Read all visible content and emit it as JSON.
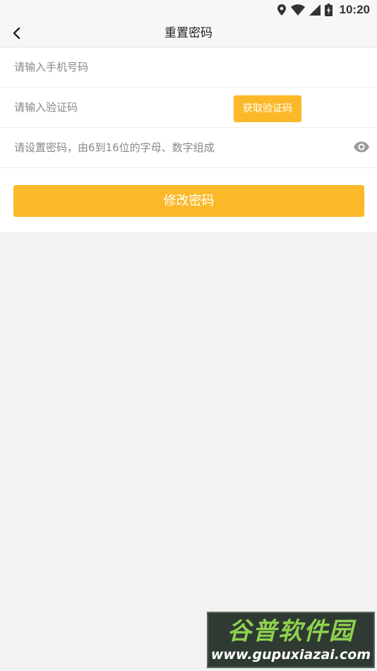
{
  "status_bar": {
    "time": "10:20",
    "icons": [
      "location-icon",
      "wifi-icon",
      "signal-icon",
      "battery-charging-icon"
    ]
  },
  "toolbar": {
    "title": "重置密码",
    "back_icon": "chevron-left-icon"
  },
  "form": {
    "phone_placeholder": "请输入手机号码",
    "code_placeholder": "请输入验证码",
    "get_code_label": "获取验证码",
    "password_placeholder": "请设置密码，由6到16位的字母、数字组成",
    "password_toggle_icon": "eye-icon",
    "submit_label": "修改密码"
  },
  "colors": {
    "accent": "#fbb929",
    "background": "#f2f2f2",
    "form_background": "#ffffff"
  },
  "watermark": {
    "title": "谷普软件园",
    "url": "www.gupuxiazai.com"
  }
}
